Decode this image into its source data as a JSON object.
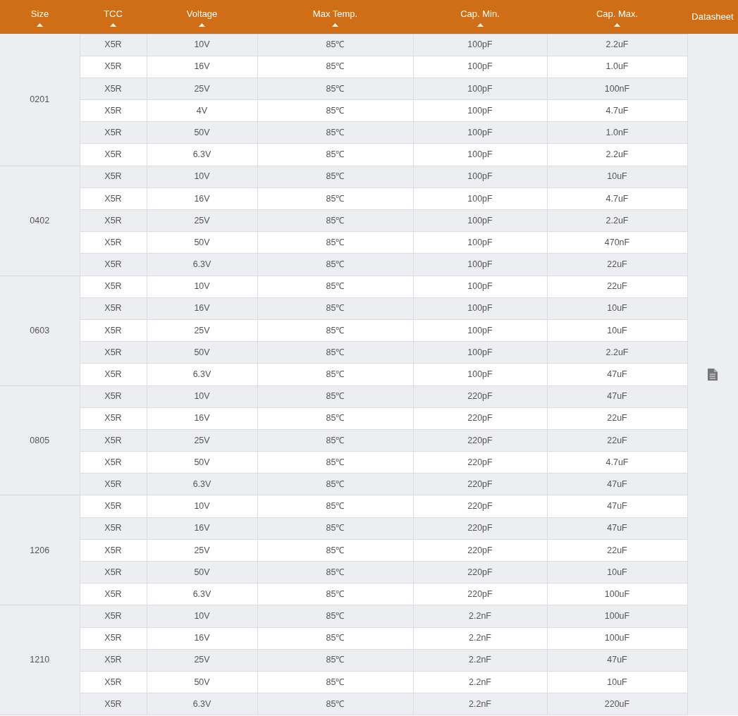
{
  "table": {
    "columns": [
      {
        "label": "Size",
        "sortable": true
      },
      {
        "label": "TCC",
        "sortable": true
      },
      {
        "label": "Voltage",
        "sortable": true
      },
      {
        "label": "Max Temp.",
        "sortable": true
      },
      {
        "label": "Cap. Min.",
        "sortable": true
      },
      {
        "label": "Cap. Max.",
        "sortable": true
      },
      {
        "label": "Datasheet",
        "sortable": false
      }
    ],
    "groups": [
      {
        "size": "0201",
        "rows": [
          [
            "X5R",
            "10V",
            "85℃",
            "100pF",
            "2.2uF"
          ],
          [
            "X5R",
            "16V",
            "85℃",
            "100pF",
            "1.0uF"
          ],
          [
            "X5R",
            "25V",
            "85℃",
            "100pF",
            "100nF"
          ],
          [
            "X5R",
            "4V",
            "85℃",
            "100pF",
            "4.7uF"
          ],
          [
            "X5R",
            "50V",
            "85℃",
            "100pF",
            "1.0nF"
          ],
          [
            "X5R",
            "6.3V",
            "85℃",
            "100pF",
            "2.2uF"
          ]
        ]
      },
      {
        "size": "0402",
        "rows": [
          [
            "X5R",
            "10V",
            "85℃",
            "100pF",
            "10uF"
          ],
          [
            "X5R",
            "16V",
            "85℃",
            "100pF",
            "4.7uF"
          ],
          [
            "X5R",
            "25V",
            "85℃",
            "100pF",
            "2.2uF"
          ],
          [
            "X5R",
            "50V",
            "85℃",
            "100pF",
            "470nF"
          ],
          [
            "X5R",
            "6.3V",
            "85℃",
            "100pF",
            "22uF"
          ]
        ]
      },
      {
        "size": "0603",
        "rows": [
          [
            "X5R",
            "10V",
            "85℃",
            "100pF",
            "22uF"
          ],
          [
            "X5R",
            "16V",
            "85℃",
            "100pF",
            "10uF"
          ],
          [
            "X5R",
            "25V",
            "85℃",
            "100pF",
            "10uF"
          ],
          [
            "X5R",
            "50V",
            "85℃",
            "100pF",
            "2.2uF"
          ],
          [
            "X5R",
            "6.3V",
            "85℃",
            "100pF",
            "47uF"
          ]
        ]
      },
      {
        "size": "0805",
        "rows": [
          [
            "X5R",
            "10V",
            "85℃",
            "220pF",
            "47uF"
          ],
          [
            "X5R",
            "16V",
            "85℃",
            "220pF",
            "22uF"
          ],
          [
            "X5R",
            "25V",
            "85℃",
            "220pF",
            "22uF"
          ],
          [
            "X5R",
            "50V",
            "85℃",
            "220pF",
            "4.7uF"
          ],
          [
            "X5R",
            "6.3V",
            "85℃",
            "220pF",
            "47uF"
          ]
        ]
      },
      {
        "size": "1206",
        "rows": [
          [
            "X5R",
            "10V",
            "85℃",
            "220pF",
            "47uF"
          ],
          [
            "X5R",
            "16V",
            "85℃",
            "220pF",
            "47uF"
          ],
          [
            "X5R",
            "25V",
            "85℃",
            "220pF",
            "22uF"
          ],
          [
            "X5R",
            "50V",
            "85℃",
            "220pF",
            "10uF"
          ],
          [
            "X5R",
            "6.3V",
            "85℃",
            "220pF",
            "100uF"
          ]
        ]
      },
      {
        "size": "1210",
        "rows": [
          [
            "X5R",
            "10V",
            "85℃",
            "2.2nF",
            "100uF"
          ],
          [
            "X5R",
            "16V",
            "85℃",
            "2.2nF",
            "100uF"
          ],
          [
            "X5R",
            "25V",
            "85℃",
            "2.2nF",
            "47uF"
          ],
          [
            "X5R",
            "50V",
            "85℃",
            "2.2nF",
            "10uF"
          ],
          [
            "X5R",
            "6.3V",
            "85℃",
            "2.2nF",
            "220uF"
          ]
        ]
      }
    ]
  }
}
